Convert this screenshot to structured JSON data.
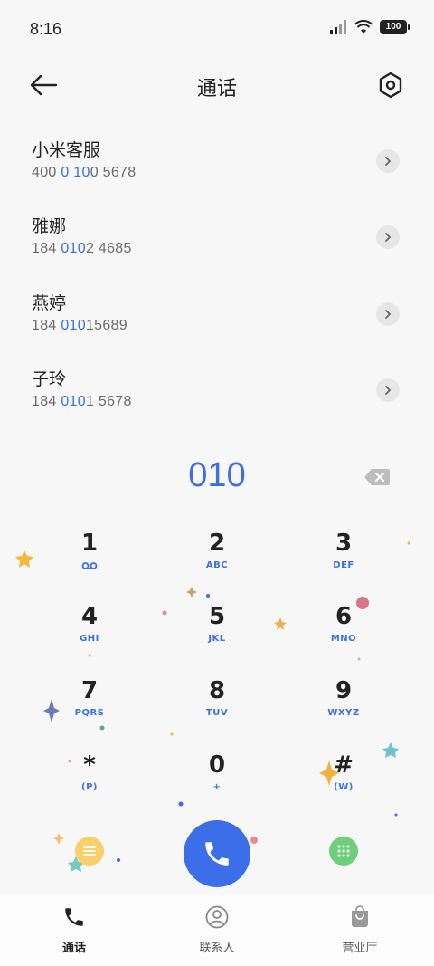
{
  "status_bar": {
    "time": "8:16",
    "battery": "100"
  },
  "header": {
    "title": "通话"
  },
  "contacts": [
    {
      "name": "小米客服",
      "number_pre": "400 ",
      "number_hl": "0 10",
      "number_post": "0 5678"
    },
    {
      "name": "雅娜",
      "number_pre": "184 ",
      "number_hl": "010",
      "number_post": "2 4685"
    },
    {
      "name": "燕婷",
      "number_pre": "184 ",
      "number_hl": "010",
      "number_post": "15689"
    },
    {
      "name": "子玲",
      "number_pre": "184 ",
      "number_hl": "010",
      "number_post": "1 5678"
    }
  ],
  "dialer": {
    "entered_number": "010"
  },
  "keypad": [
    {
      "digit": "1",
      "letters": ""
    },
    {
      "digit": "2",
      "letters": "ABC"
    },
    {
      "digit": "3",
      "letters": "DEF"
    },
    {
      "digit": "4",
      "letters": "GHI"
    },
    {
      "digit": "5",
      "letters": "JKL"
    },
    {
      "digit": "6",
      "letters": "MNO"
    },
    {
      "digit": "7",
      "letters": "PQRS"
    },
    {
      "digit": "8",
      "letters": "TUV"
    },
    {
      "digit": "9",
      "letters": "WXYZ"
    },
    {
      "digit": "*",
      "letters": "(P)"
    },
    {
      "digit": "0",
      "letters": "+"
    },
    {
      "digit": "#",
      "letters": "(W)"
    }
  ],
  "actions": {
    "menu_color": "#f9cf6b",
    "call_color": "#3b6ee8",
    "keypad_toggle_color": "#6fcf7c"
  },
  "tabs": [
    {
      "label": "通话",
      "icon": "phone-icon",
      "active": true
    },
    {
      "label": "联系人",
      "icon": "contact-icon",
      "active": false
    },
    {
      "label": "营业厅",
      "icon": "store-bag-icon",
      "active": false
    }
  ]
}
